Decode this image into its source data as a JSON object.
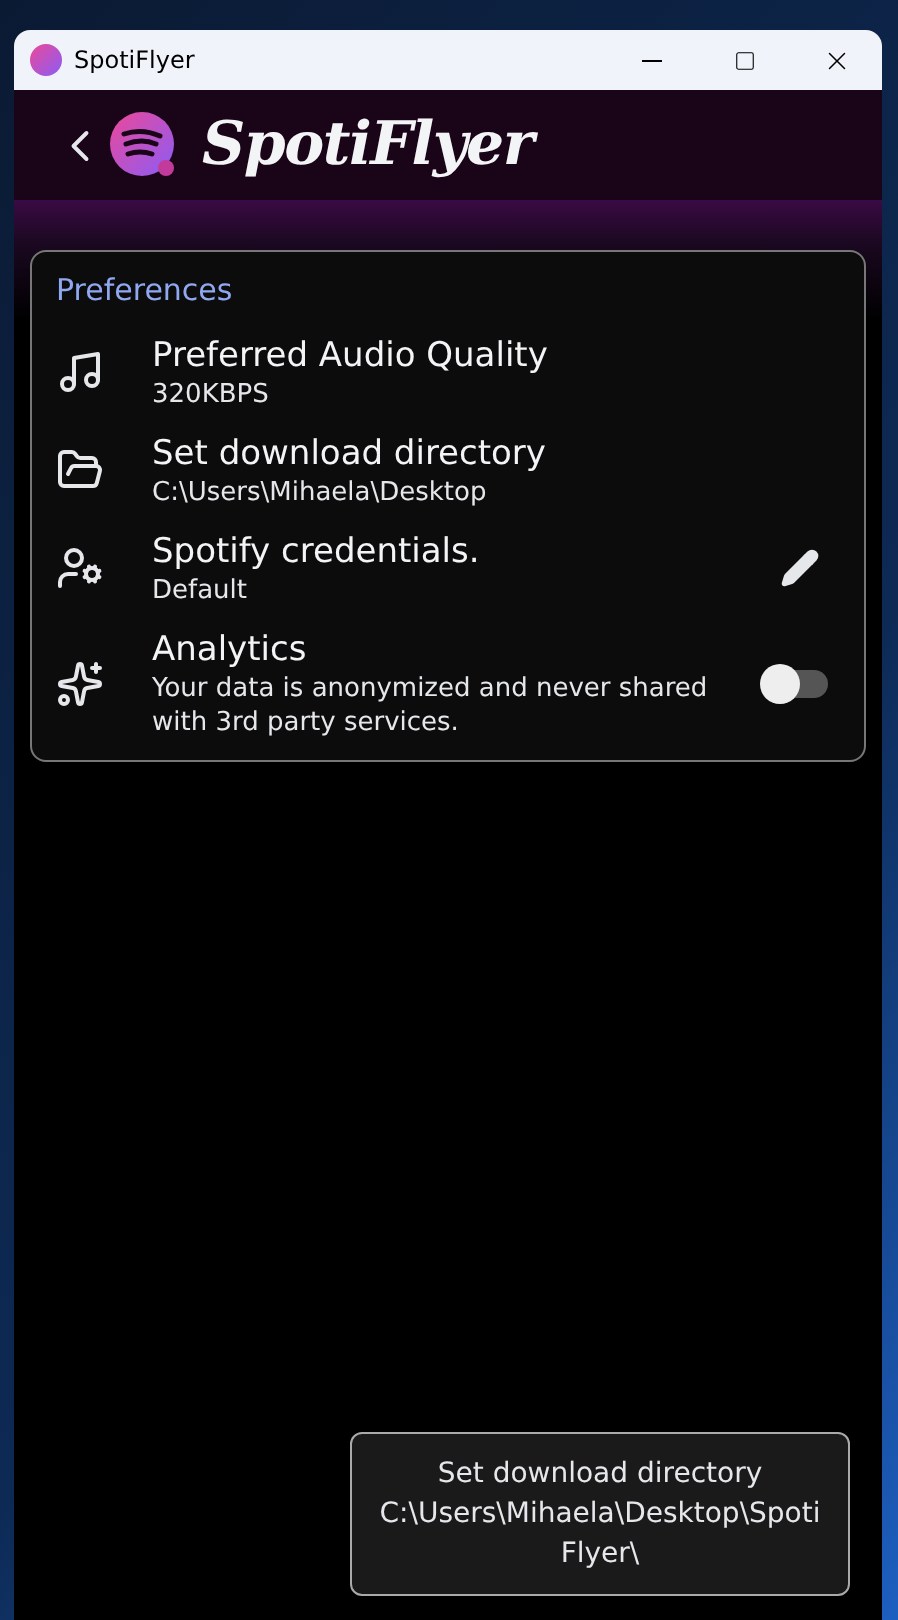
{
  "window": {
    "title": "SpotiFlyer"
  },
  "header": {
    "logo_text": "SpotiFlyer"
  },
  "preferences": {
    "title": "Preferences",
    "items": [
      {
        "kind": "plain",
        "title": "Preferred Audio Quality",
        "subtitle": "320KBPS"
      },
      {
        "kind": "plain",
        "title": "Set download directory",
        "subtitle": "C:\\Users\\Mihaela\\Desktop"
      },
      {
        "kind": "edit",
        "title": "Spotify credentials.",
        "subtitle": "Default"
      },
      {
        "kind": "toggle",
        "title": "Analytics",
        "subtitle": "Your data is anonymized and never shared with 3rd party services.",
        "on": false
      }
    ]
  },
  "toast": {
    "title": "Set download directory",
    "message": "C:\\Users\\Mihaela\\Desktop\\SpotiFlyer\\"
  }
}
